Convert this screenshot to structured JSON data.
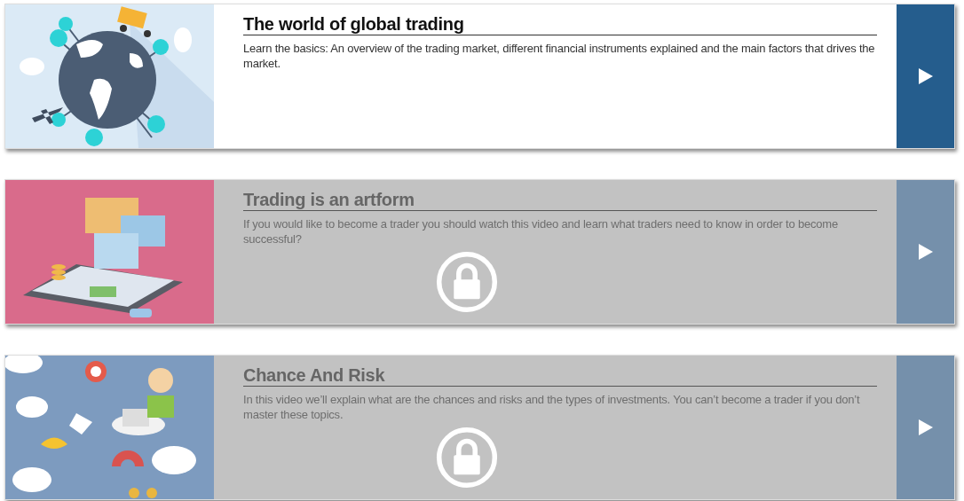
{
  "courses": [
    {
      "kind": "globe",
      "title": "The world of global trading",
      "description": "Learn the basics: An overview of the trading market, different financial instruments explained and the main factors that drives the market.",
      "locked": false
    },
    {
      "kind": "tablet",
      "title": "Trading is an artform",
      "description": "If you would like to become a trader you should watch this video and learn what traders need to know in order to become successful?",
      "locked": true
    },
    {
      "kind": "infographic",
      "title": "Chance And Risk",
      "description": "In this video we’ll explain what are the chances and risks and the types of investments. You can’t become a trader if you don’t master these topics.",
      "locked": true
    }
  ]
}
